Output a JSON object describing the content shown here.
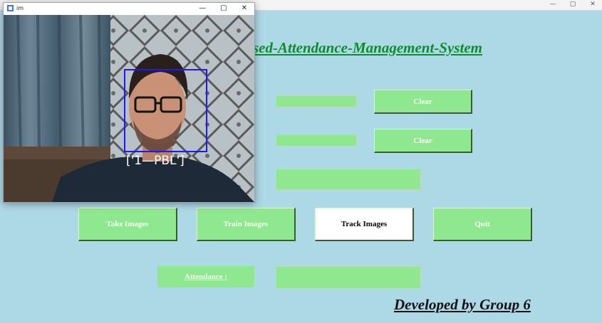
{
  "main_window": {
    "controls": [
      "—",
      "▢",
      "✕"
    ]
  },
  "title": "sed-Attendance-Management-System",
  "buttons": {
    "clear1": "Clear",
    "clear2": "Clear",
    "take_images": "Take Images",
    "train_images": "Train Images",
    "track_images": "Track Images",
    "quit": "Quit"
  },
  "attendance_label": "Attendance :",
  "footer": "Developed by Group 6",
  "camera_window": {
    "title": "im",
    "controls": [
      "—",
      "▢",
      "✕"
    ],
    "prediction_label": "['1—PBL']",
    "box_color": "#1a1aff"
  },
  "colors": {
    "background": "#add8e6",
    "accent_green": "#8fe88f",
    "title_green": "#0b8f2a"
  }
}
